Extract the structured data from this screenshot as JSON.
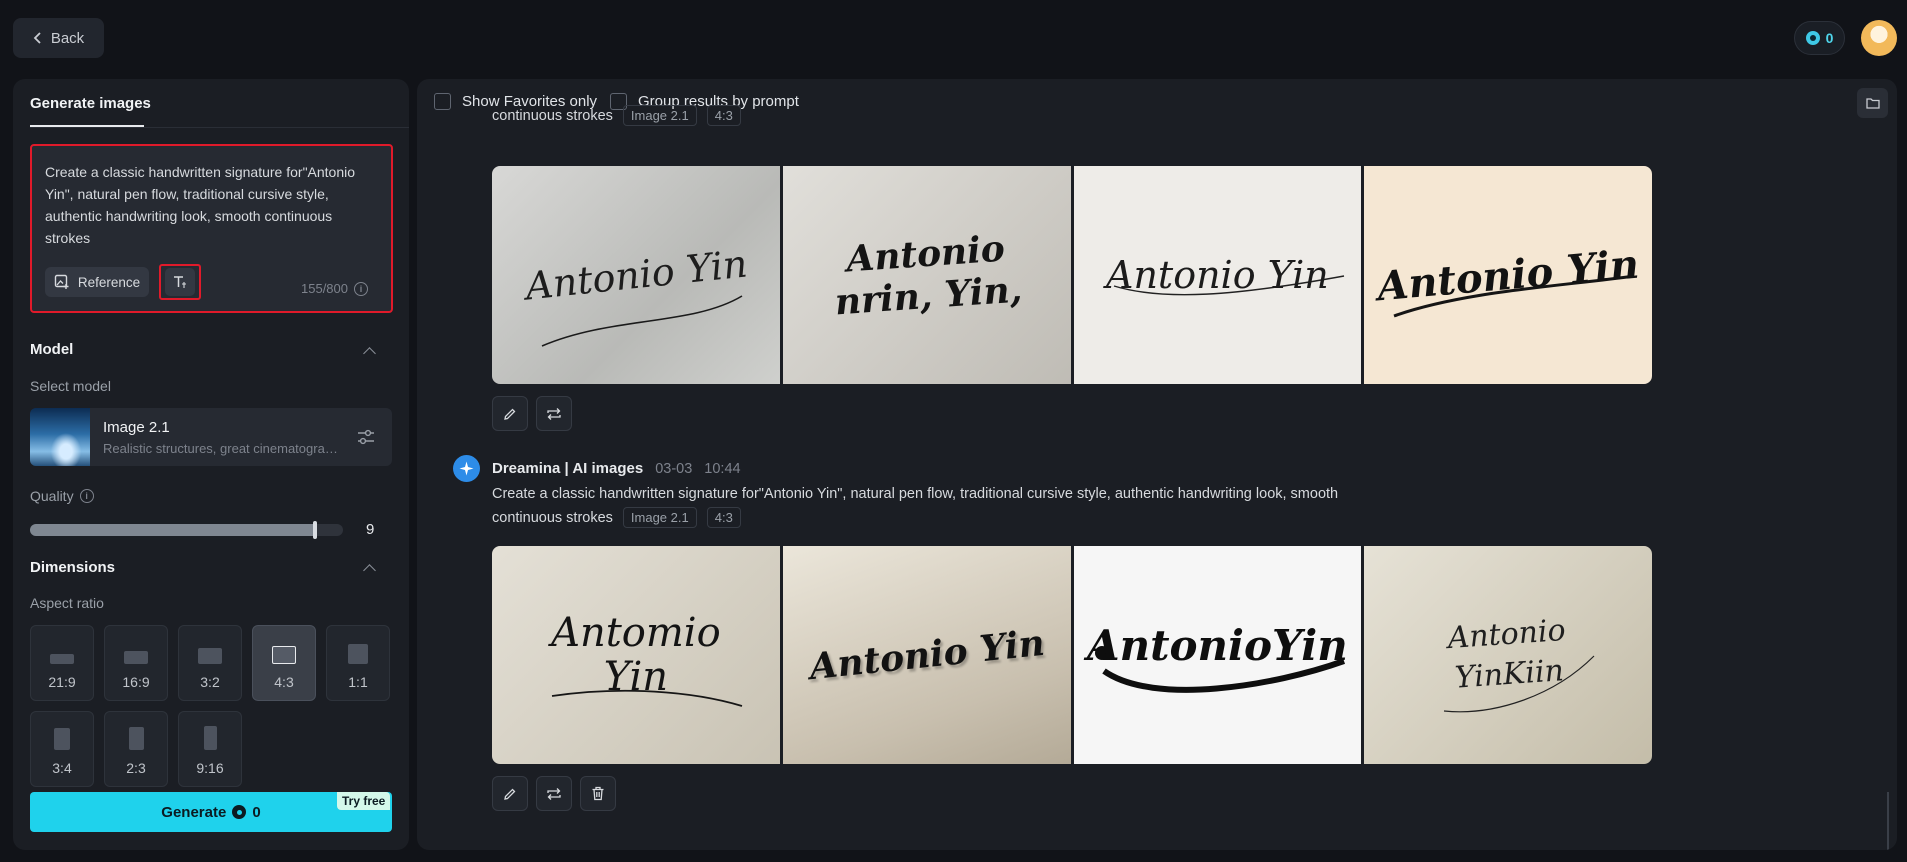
{
  "header": {
    "back_label": "Back",
    "credits": "0"
  },
  "left": {
    "tab_label": "Generate images",
    "prompt_text": "Create a classic handwritten signature for\"Antonio Yin\", natural pen flow, traditional cursive style, authentic handwriting look, smooth continuous strokes",
    "reference_label": "Reference",
    "char_count": "155/800",
    "model_section": "Model",
    "select_model_label": "Select model",
    "model_name": "Image 2.1",
    "model_desc": "Realistic structures, great cinematography",
    "quality_label": "Quality",
    "quality_value": "9",
    "quality_fraction": 0.91,
    "dimensions_section": "Dimensions",
    "aspect_ratio_label": "Aspect ratio",
    "ratios": [
      "21:9",
      "16:9",
      "3:2",
      "4:3",
      "1:1",
      "3:4",
      "2:3",
      "9:16"
    ],
    "selected_ratio": "4:3",
    "generate_label": "Generate",
    "generate_cost": "0",
    "try_free_label": "Try free"
  },
  "right": {
    "show_favorites_label": "Show Favorites only",
    "group_results_label": "Group results by prompt",
    "group1": {
      "prompt_tail": "continuous strokes",
      "model_tag": "Image 2.1",
      "ratio_tag": "4:3",
      "signatures": [
        "Antonio Yin",
        "Antonio nrin, Yin,",
        "Antonio Yin",
        "Antonio Yin"
      ]
    },
    "group2": {
      "agent_name": "Dreamina | AI images",
      "date": "03-03",
      "time": "10:44",
      "prompt": "Create a classic handwritten signature for\"Antonio Yin\", natural pen flow, traditional cursive style, authentic handwriting look, smooth",
      "prompt_tail": "continuous strokes",
      "model_tag": "Image 2.1",
      "ratio_tag": "4:3",
      "signatures": [
        "Antomio Yin",
        "Antonio Yin",
        "AntonioYin",
        "Antonio YinKiin"
      ]
    }
  },
  "colors": {
    "accent": "#1fd2ec",
    "highlight": "#e01a2a"
  }
}
